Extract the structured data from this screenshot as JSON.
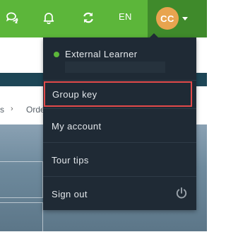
{
  "topbar": {
    "icons": [
      "chat-icon",
      "bell-icon",
      "refresh-icon"
    ],
    "language": "EN",
    "avatar_initials": "CC",
    "colors": {
      "bar": "#5cb63a",
      "user_cell": "#3f8a2b",
      "avatar": "#e8a44f"
    }
  },
  "background": {
    "nav_tail": "s",
    "nav_next": "Orde"
  },
  "user_menu": {
    "status": "online",
    "user_name": "External Learner",
    "items": [
      {
        "label": "Group key",
        "highlighted": true
      },
      {
        "label": "My account"
      },
      {
        "label": "Tour tips"
      },
      {
        "label": "Sign out",
        "icon": "power-icon"
      }
    ],
    "colors": {
      "menu_bg": "#1f2a35",
      "highlight_border": "#e24a4a",
      "status_dot": "#5cb63a"
    }
  }
}
